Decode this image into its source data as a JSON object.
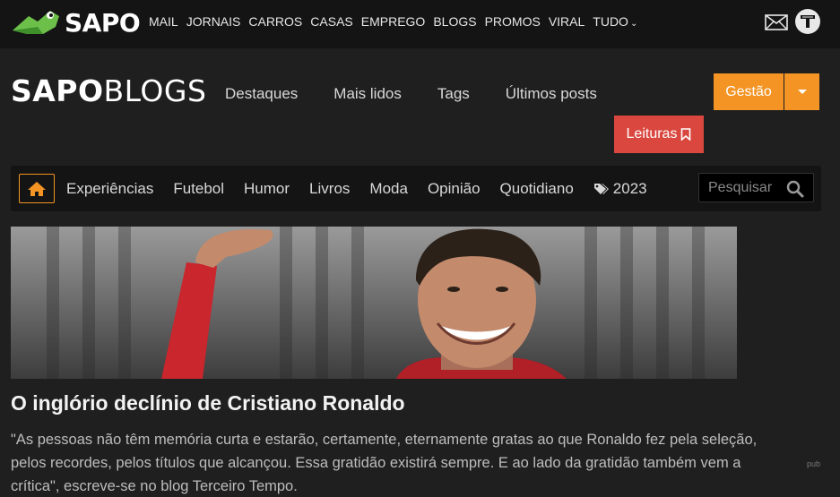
{
  "topbar": {
    "brand": "SAPO",
    "links": [
      "MAIL",
      "JORNAIS",
      "CARROS",
      "CASAS",
      "EMPREGO",
      "BLOGS",
      "PROMOS",
      "VIRAL",
      "TUDO"
    ],
    "icons": [
      "mail-envelope-icon",
      "t-account-icon"
    ]
  },
  "header": {
    "logo_bold": "SAPO",
    "logo_light": "BLOGS",
    "nav": [
      "Destaques",
      "Mais lidos",
      "Tags",
      "Últimos posts"
    ],
    "gestao_label": "Gestão",
    "leituras_label": "Leituras"
  },
  "categories": {
    "items": [
      "Experiências",
      "Futebol",
      "Humor",
      "Livros",
      "Moda",
      "Opinião",
      "Quotidiano"
    ],
    "tag_item": "2023",
    "search_placeholder": "Pesquisar"
  },
  "featured": {
    "title": "O inglório declínio de Cristiano Ronaldo",
    "excerpt": "\"As pessoas não têm memória curta e estarão, certamente, eternamente gratas ao que Ronaldo fez pela seleção, pelos recordes, pelos títulos que alcançou. Essa gratidão existirá sempre. E ao lado da gratidão também vem a crítica\", escreve-se no blog Terceiro Tempo."
  },
  "ad_label": "pub",
  "colors": {
    "accent_orange": "#f39424",
    "accent_red": "#d9473f",
    "brand_green": "#6cc04a"
  }
}
